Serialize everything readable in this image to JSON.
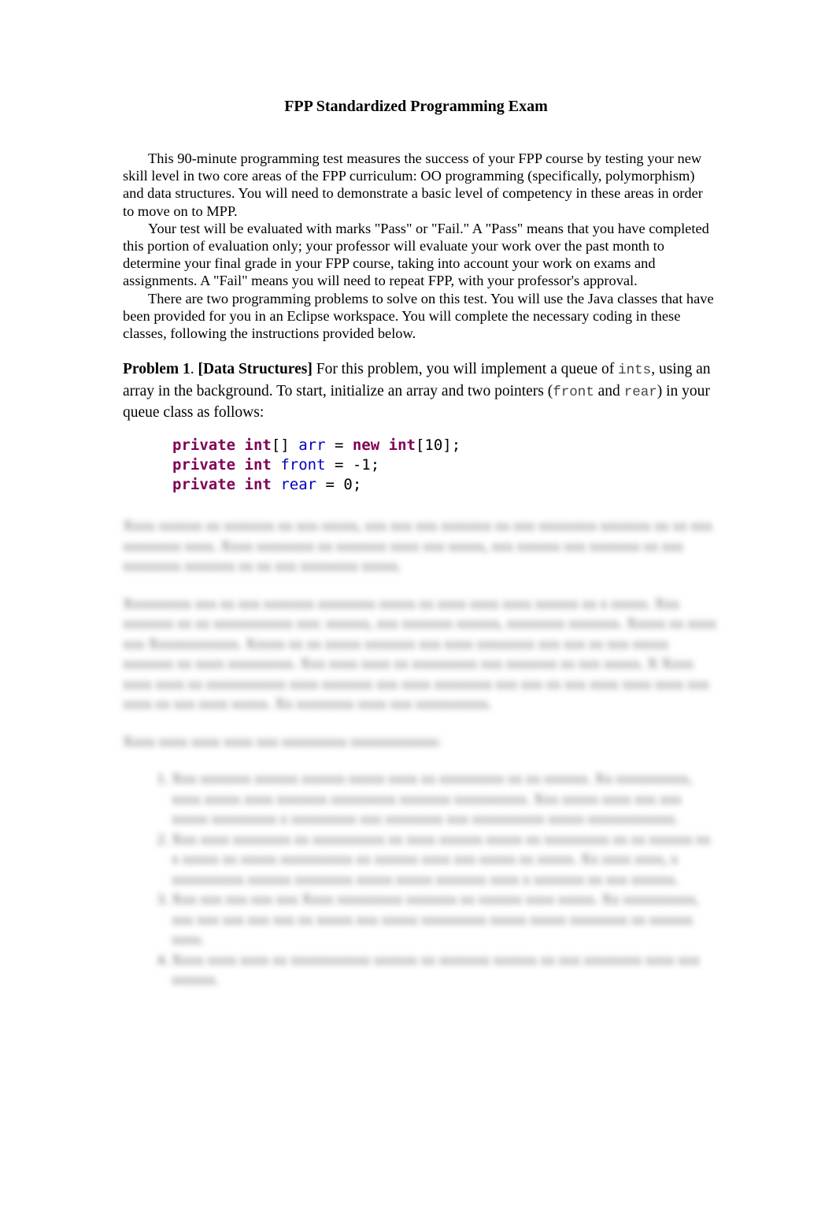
{
  "document": {
    "title": "FPP Standardized Programming Exam",
    "intro_paragraphs": [
      "This 90-minute programming test measures the success of your FPP course by testing your new skill level in two core areas of the FPP curriculum: OO programming (specifically, polymorphism)  and data structures. You will need to demonstrate a basic level of competency in these areas in order to move on to MPP.",
      "Your test will be evaluated with marks \"Pass\" or \"Fail.\" A \"Pass\" means that you have completed this portion of evaluation only; your professor will evaluate your work over the past month to determine your final grade in your FPP course, taking into account your work on exams and assignments. A \"Fail\" means you will need to repeat FPP, with your professor's approval.",
      "There are two programming problems to solve on this test. You will use the Java classes that have been provided for you in an Eclipse workspace. You will complete the necessary coding in these classes, following the instructions provided below."
    ],
    "problem1": {
      "label": "Problem 1",
      "sep": ". ",
      "category": "[Data Structures]",
      "text_a": " For this problem, you will implement a queue of ",
      "code_ints": "ints",
      "text_b": ", using an array in the background. To start, initialize an array and two pointers (",
      "code_front": "front",
      "text_c": " and ",
      "code_rear": "rear",
      "text_d": ") in your queue class as follows:"
    },
    "code_lines": [
      {
        "kw1": "private",
        "kw2": "int",
        "rest1": "[] ",
        "field": "arr",
        "rest2": " = ",
        "kw3": "new",
        "kw4": "int",
        "rest3": "[10];"
      },
      {
        "kw1": "private",
        "kw2": "int",
        "rest1": " ",
        "field": "front",
        "rest2": " = -1;"
      },
      {
        "kw1": "private",
        "kw2": "int",
        "rest1": " ",
        "field": "rear",
        "rest2": " = 0;"
      }
    ],
    "blurred_notice": "Remaining content is obscured (blurred) in the screenshot"
  },
  "colors": {
    "keyword": "#7f0055",
    "field": "#0000c0"
  }
}
